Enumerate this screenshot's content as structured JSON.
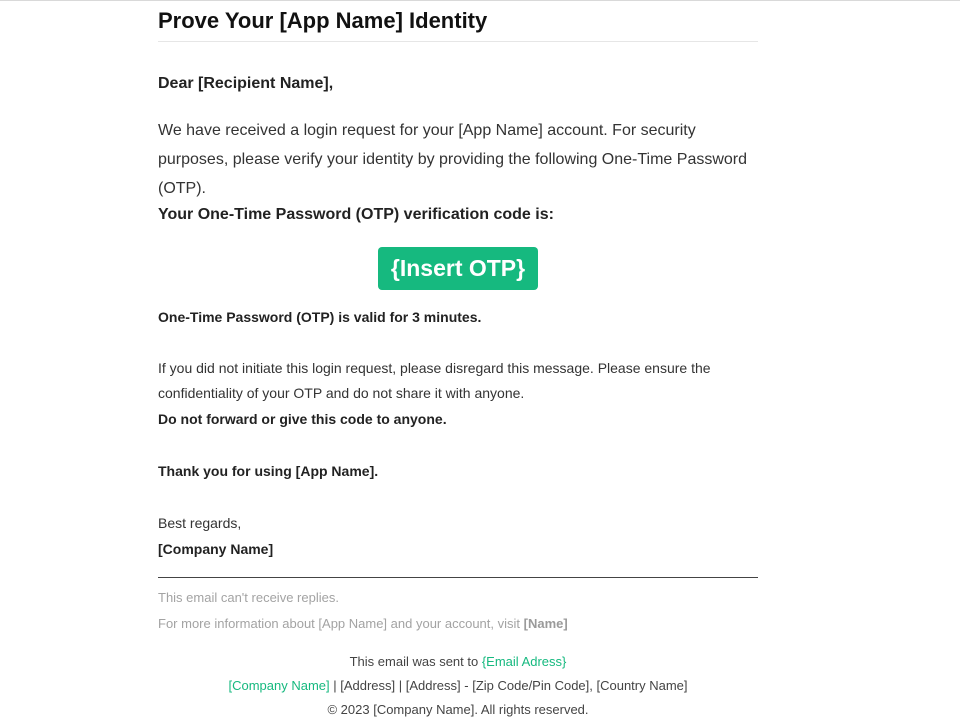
{
  "email": {
    "title": "Prove Your [App Name] Identity",
    "greeting": "Dear [Recipient Name],",
    "intro": "We have received a login request for your [App Name] account. For security purposes, please verify your identity by providing the following One-Time Password (OTP).",
    "code_label": "Your One-Time Password (OTP) verification code is:",
    "otp_placeholder": "{Insert OTP}",
    "validity": "One-Time Password (OTP) is valid for 3 minutes.",
    "disclaimer": "If you did not initiate this login request, please disregard this message. Please ensure the confidentiality of your OTP and do not share it with anyone.",
    "no_forward": "Do not forward or give this code to anyone.",
    "thanks": "Thank you for using [App Name].",
    "regards": "Best regards,",
    "company_sign": "[Company Name]"
  },
  "footer": {
    "no_reply": "This email can't receive replies.",
    "more_info_prefix": "For more information about [App Name] and your account, visit ",
    "more_info_link": "[Name]",
    "sent_to_prefix": "This email was sent to ",
    "sent_to_email": "{Email Adress}",
    "company_link": "[Company Name]",
    "address_line": " | [Address] | [Address] - [Zip Code/Pin Code], [Country Name]",
    "copyright": "© 2023 [Company Name]. All rights reserved."
  },
  "colors": {
    "accent": "#16b97f",
    "muted_text": "#a3a3a3"
  }
}
